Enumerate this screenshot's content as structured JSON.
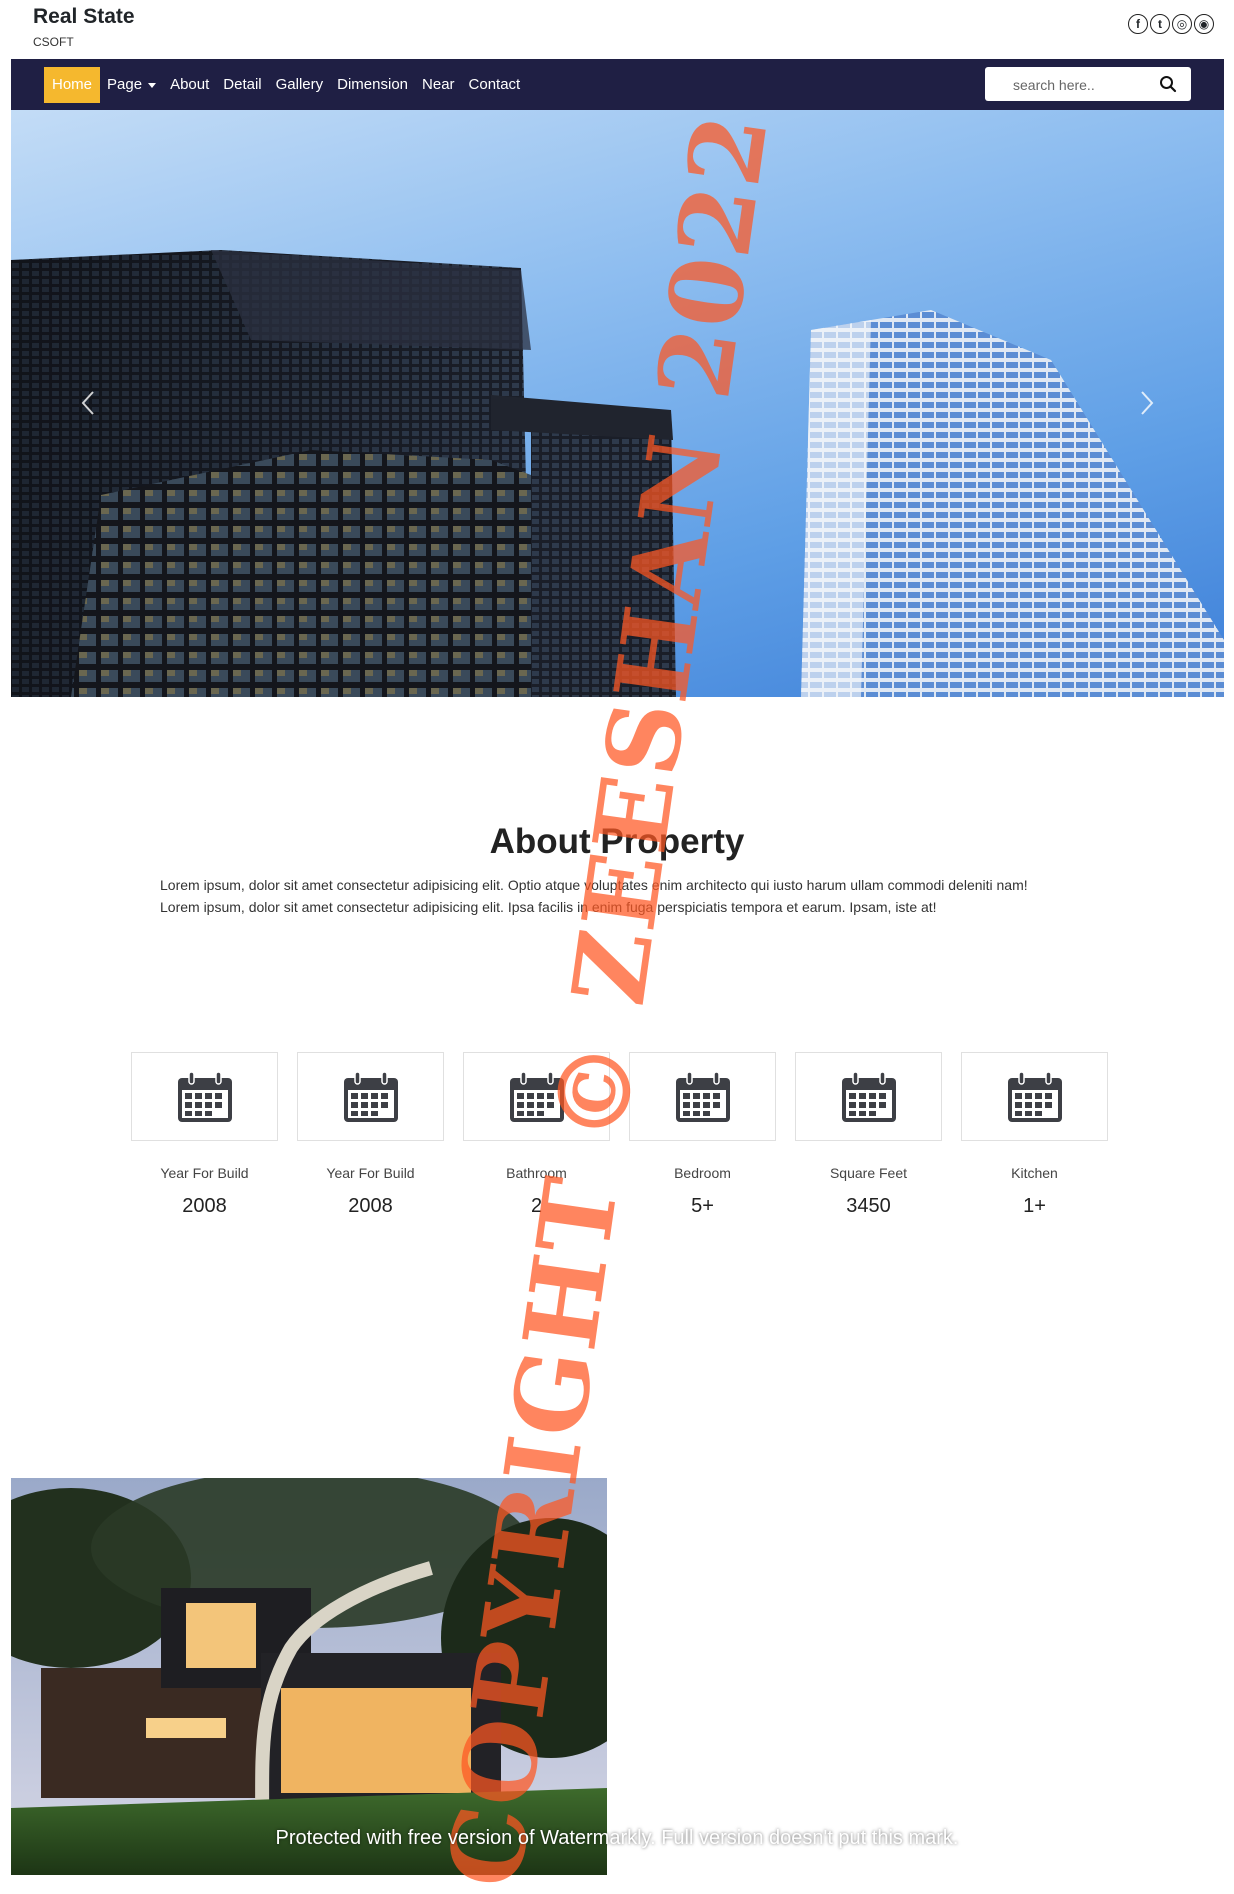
{
  "brand": {
    "name": "Real State",
    "subtitle": "CSOFT"
  },
  "socials": [
    {
      "icon": "facebook-icon",
      "glyph": "f"
    },
    {
      "icon": "twitter-icon",
      "glyph": "t"
    },
    {
      "icon": "instagram-icon",
      "glyph": "◎"
    },
    {
      "icon": "reddit-icon",
      "glyph": "◉"
    }
  ],
  "nav": {
    "items": [
      "Home",
      "Page",
      "About",
      "Detail",
      "Gallery",
      "Dimension",
      "Near",
      "Contact"
    ],
    "active": "Home"
  },
  "search": {
    "placeholder": "search here.."
  },
  "about": {
    "title": "About Property",
    "line1": "Lorem ipsum, dolor sit amet consectetur adipisicing elit. Optio atque voluptates enim architecto qui iusto harum ullam commodi deleniti nam!",
    "line2": "Lorem ipsum, dolor sit amet consectetur adipisicing elit. Ipsa facilis in enim fuga perspiciatis tempora et earum. Ipsam, iste at!"
  },
  "stats": [
    {
      "label": "Year For Build",
      "value": "2008",
      "icon": "calendar-icon"
    },
    {
      "label": "Year For Build",
      "value": "2008",
      "icon": "calendar-icon"
    },
    {
      "label": "Bathroom",
      "value": "2",
      "icon": "calendar-icon"
    },
    {
      "label": "Bedroom",
      "value": "5+",
      "icon": "calendar-icon"
    },
    {
      "label": "Square Feet",
      "value": "3450",
      "icon": "calendar-icon"
    },
    {
      "label": "Kitchen",
      "value": "1+",
      "icon": "calendar-icon"
    }
  ],
  "watermark": {
    "vertical": "COPYRIGHT © ZEESHAN 2022",
    "footer": "Protected with free version of Watermarkly. Full version doesn't put this mark."
  },
  "colors": {
    "navbar": "#1f1f44",
    "active": "#f5b82e",
    "watermark": "#ff5722"
  }
}
